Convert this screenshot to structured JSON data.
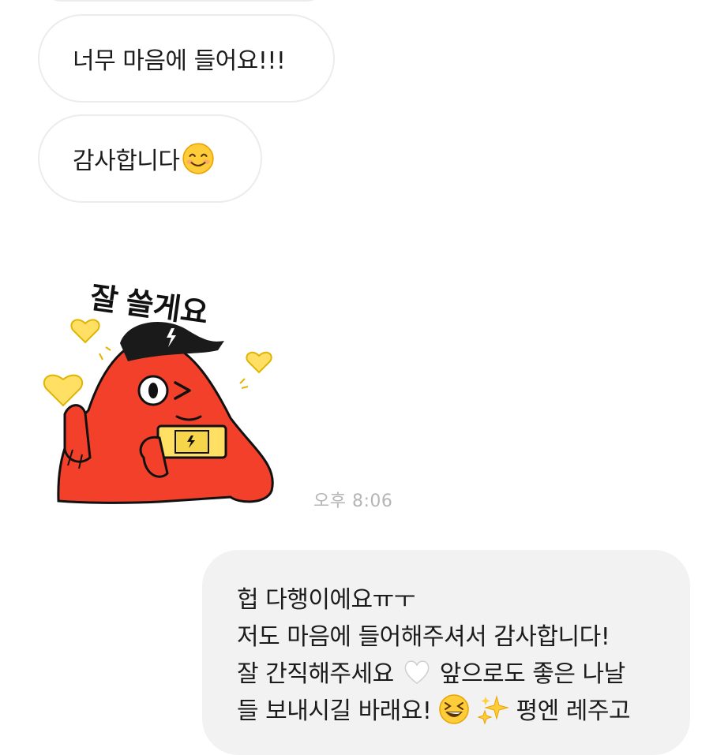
{
  "chat": {
    "received": [
      {
        "text": "너무 마음에 들어요!!!"
      },
      {
        "text": "감사합니다",
        "emoji": "smiling-face-emoji"
      }
    ],
    "sticker": {
      "text": "잘 쓸게요",
      "icon": "red-character-sticker"
    },
    "timestamp": "오후 8:06",
    "sent": {
      "line1": "헙 다행이에요ㅠㅜ",
      "line2": "저도 마음에 들어해주셔서 감사합니다!",
      "line3a": "잘 간직해주세요",
      "line3b": "앞으로도 좋은 나날",
      "line4a": "들 보내시길 바래요!",
      "line4b": "평엔 레주고"
    }
  },
  "colors": {
    "received_bubble_bg": "#ffffff",
    "received_bubble_border": "#ececec",
    "sent_bubble_bg": "#f2f2f2",
    "timestamp": "#b5b5b5",
    "sticker_red": "#f2402a",
    "sticker_yellow": "#ffe065"
  }
}
